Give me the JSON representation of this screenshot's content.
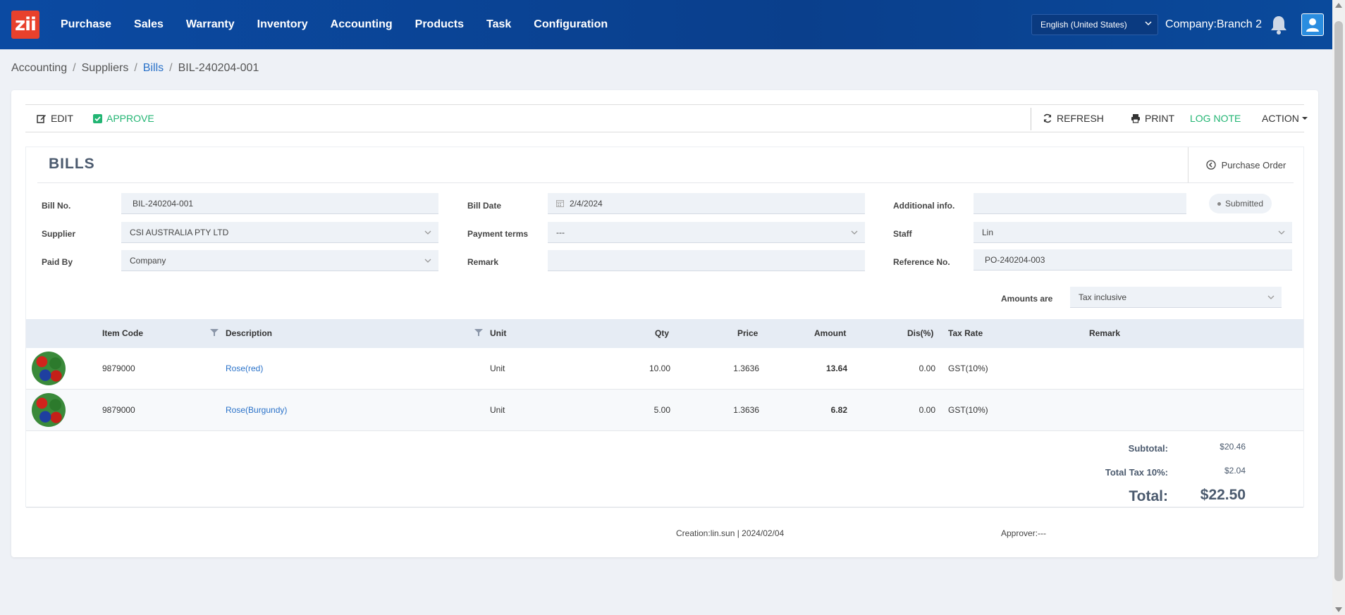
{
  "nav": {
    "logo": "zii",
    "items": [
      "Purchase",
      "Sales",
      "Warranty",
      "Inventory",
      "Accounting",
      "Products",
      "Task",
      "Configuration"
    ],
    "language": "English (United States)",
    "company": "Company:Branch 2"
  },
  "breadcrumb": {
    "items": [
      "Accounting",
      "Suppliers",
      "Bills",
      "BIL-240204-001"
    ]
  },
  "toolbar": {
    "edit": "EDIT",
    "approve": "APPROVE",
    "refresh": "REFRESH",
    "print": "PRINT",
    "log_note": "LOG NOTE",
    "action": "ACTION"
  },
  "form": {
    "title": "BILLS",
    "purchase_order": "Purchase Order",
    "bill_no_label": "Bill No.",
    "bill_no": "BIL-240204-001",
    "supplier_label": "Supplier",
    "supplier": "CSI AUSTRALIA PTY LTD",
    "paid_by_label": "Paid By",
    "paid_by": "Company",
    "bill_date_label": "Bill Date",
    "bill_date": "2/4/2024",
    "payment_terms_label": "Payment terms",
    "payment_terms": "---",
    "remark_label": "Remark",
    "remark": "",
    "additional_info_label": "Additional info.",
    "additional_info": "",
    "status": "Submitted",
    "staff_label": "Staff",
    "staff": "Lin",
    "reference_label": "Reference No.",
    "reference": "PO-240204-003",
    "amounts_are_label": "Amounts are",
    "amounts_are": "Tax inclusive"
  },
  "table": {
    "headers": {
      "item_code": "Item Code",
      "description": "Description",
      "unit": "Unit",
      "qty": "Qty",
      "price": "Price",
      "amount": "Amount",
      "dis": "Dis(%)",
      "tax_rate": "Tax Rate",
      "remark": "Remark"
    },
    "rows": [
      {
        "item_code": "9879000",
        "description": "Rose(red)",
        "unit": "Unit",
        "qty": "10.00",
        "price": "1.3636",
        "amount": "13.64",
        "dis": "0.00",
        "tax_rate": "GST(10%)",
        "remark": ""
      },
      {
        "item_code": "9879000",
        "description": "Rose(Burgundy)",
        "unit": "Unit",
        "qty": "5.00",
        "price": "1.3636",
        "amount": "6.82",
        "dis": "0.00",
        "tax_rate": "GST(10%)",
        "remark": ""
      }
    ]
  },
  "totals": {
    "subtotal_label": "Subtotal:",
    "subtotal": "$20.46",
    "tax_label": "Total Tax 10%:",
    "tax": "$2.04",
    "total_label": "Total:",
    "total": "$22.50"
  },
  "footer": {
    "creation": "Creation:lin.sun | 2024/02/04",
    "approver": "Approver:---"
  },
  "colors": {
    "nav_bg": "#0b4aa2",
    "accent_green": "#22b573",
    "link_blue": "#2a72c9"
  }
}
